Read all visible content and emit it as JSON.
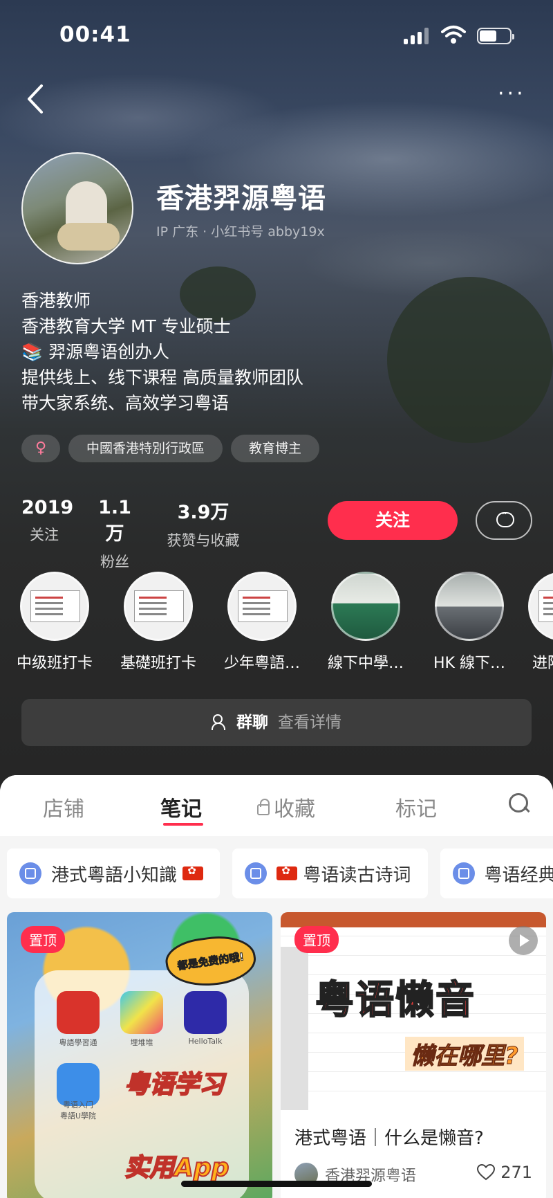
{
  "status_bar": {
    "time": "00:41"
  },
  "profile": {
    "name": "香港羿源粤语",
    "ip_line": "IP 广东 · 小红书号 abby19x",
    "bio": [
      "香港教师",
      "香港教育大学 MT 专业硕士",
      "📚 羿源粤语创办人",
      "提供线上、线下课程  高质量教师团队",
      "带大家系统、高效学习粤语"
    ],
    "tags": {
      "gender": "♀",
      "region": "中國香港特別行政區",
      "category": "教育博主"
    }
  },
  "stats": [
    {
      "num": "2019",
      "label": "关注"
    },
    {
      "num": "1.1万",
      "label": "粉丝"
    },
    {
      "num": "3.9万",
      "label": "获赞与收藏"
    }
  ],
  "actions": {
    "follow": "关注"
  },
  "highlights": [
    {
      "label": "中级班打卡"
    },
    {
      "label": "基礎班打卡"
    },
    {
      "label": "少年粵語…"
    },
    {
      "label": "線下中學…"
    },
    {
      "label": "HK 線下…"
    },
    {
      "label": "进阶"
    }
  ],
  "group_chat": {
    "title": "群聊",
    "subtitle": "查看详情"
  },
  "tabs": [
    {
      "label": "店铺"
    },
    {
      "label": "笔记"
    },
    {
      "label": "收藏"
    },
    {
      "label": "标记"
    }
  ],
  "collections": [
    {
      "label": "港式粵語小知識"
    },
    {
      "label": "粤语读古诗词"
    },
    {
      "label": "粤语经典"
    }
  ],
  "notes": [
    {
      "pin": "置顶",
      "burst_text": "都是免费的哦!",
      "apps": [
        "粵語學習通",
        "埋堆堆",
        "HelloTalk",
        "粤语入门",
        "粵語U學院"
      ],
      "overlay_1": "粤语学习",
      "overlay_2": "实用App"
    },
    {
      "pin": "置顶",
      "overlay_1": "粤语懒音",
      "overlay_2": "懒在哪里?",
      "title": "港式粤语｜什么是懒音?",
      "author": "香港羿源粤语",
      "likes": "271"
    }
  ],
  "colors": {
    "accent": "#ff2e4d",
    "collection_icon": "#6b8ee8"
  }
}
